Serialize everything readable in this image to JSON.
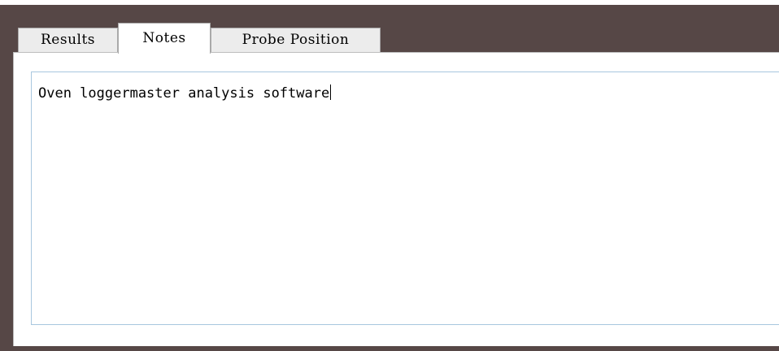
{
  "tabs": [
    {
      "label": "Results",
      "active": false
    },
    {
      "label": "Notes",
      "active": true
    },
    {
      "label": "Probe Position",
      "active": false
    }
  ],
  "notes": {
    "text": "Oven loggermaster analysis software"
  },
  "colors": {
    "frame": "#564746",
    "tab_inactive": "#ececec",
    "tab_active": "#ffffff",
    "field_border": "#a8c7df"
  }
}
